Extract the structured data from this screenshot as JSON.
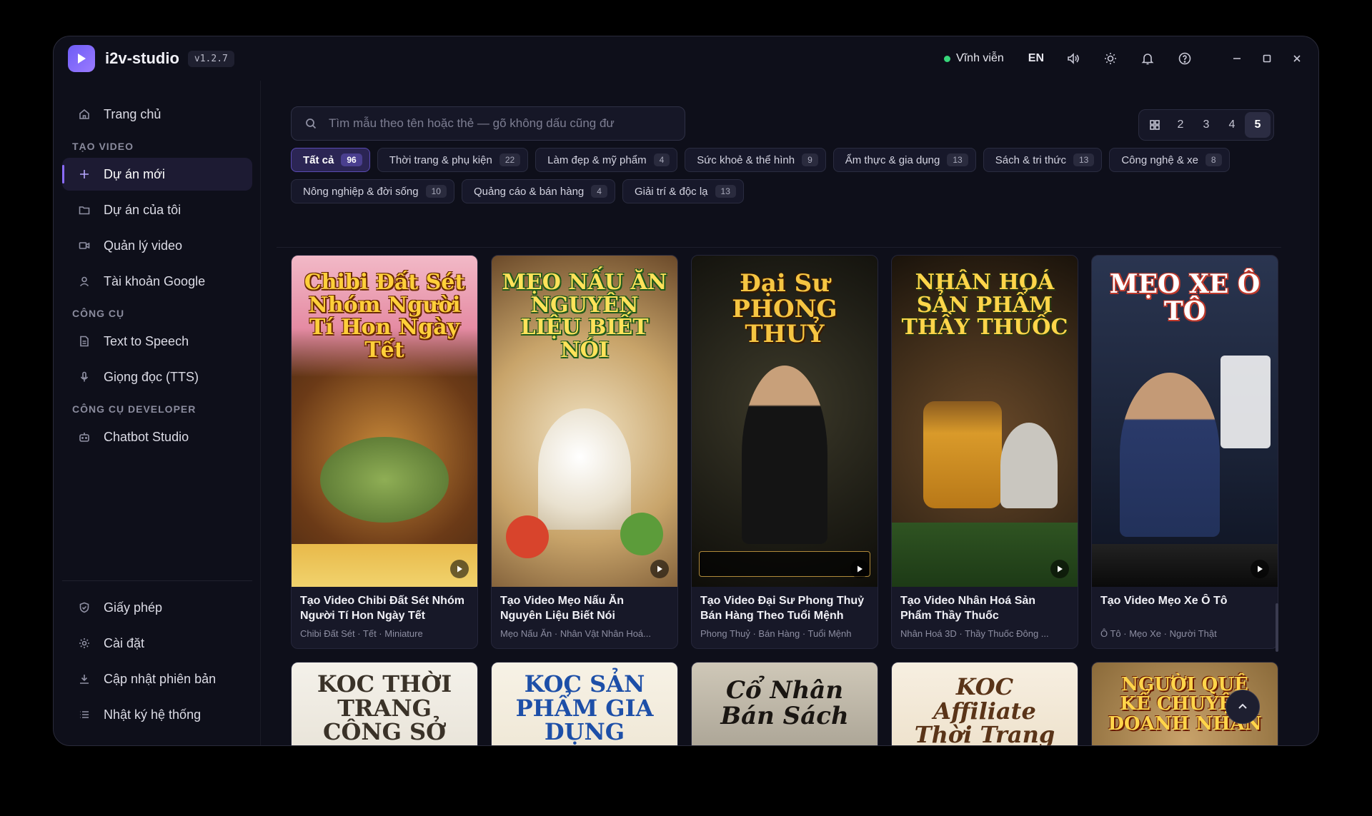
{
  "app": {
    "title": "i2v-studio",
    "version": "v1.2.7"
  },
  "titlebar": {
    "license": "Vĩnh viễn",
    "lang": "EN"
  },
  "sidebar": {
    "home": "Trang chủ",
    "section_video": "TẠO VIDEO",
    "new_project": "Dự án mới",
    "my_projects": "Dự án của tôi",
    "manage_video": "Quản lý video",
    "google_account": "Tài khoản Google",
    "section_tools": "CÔNG CỤ",
    "tts": "Text to Speech",
    "voice": "Giọng đọc (TTS)",
    "section_dev": "CÔNG CỤ DEVELOPER",
    "chatbot": "Chatbot Studio",
    "license": "Giấy phép",
    "settings": "Cài đặt",
    "update": "Cập nhật phiên bản",
    "logs": "Nhật ký hệ thống"
  },
  "search": {
    "placeholder": "Tìm mẫu theo tên hoặc thẻ — gõ không dấu cũng đư"
  },
  "columns": {
    "options": [
      "2",
      "3",
      "4",
      "5"
    ],
    "selected": "5"
  },
  "chips": [
    {
      "label": "Tất cả",
      "count": "96"
    },
    {
      "label": "Thời trang & phụ kiện",
      "count": "22"
    },
    {
      "label": "Làm đẹp & mỹ phẩm",
      "count": "4"
    },
    {
      "label": "Sức khoẻ & thể hình",
      "count": "9"
    },
    {
      "label": "Ẩm thực & gia dụng",
      "count": "13"
    },
    {
      "label": "Sách & tri thức",
      "count": "13"
    },
    {
      "label": "Công nghệ & xe",
      "count": "8"
    },
    {
      "label": "Nông nghiệp & đời sống",
      "count": "10"
    },
    {
      "label": "Quảng cáo & bán hàng",
      "count": "4"
    },
    {
      "label": "Giải trí & độc lạ",
      "count": "13"
    }
  ],
  "cards": [
    {
      "thumb_text": "Chibi Đất Sét Nhóm Người Tí Hon Ngày Tết",
      "title": "Tạo Video Chibi Đất Sét Nhóm Người Tí Hon Ngày Tết",
      "tags": "Chibi Đất Sét · Tết · Miniature"
    },
    {
      "thumb_text": "MẸO NẤU ĂN NGUYÊN LIỆU BIẾT NÓI",
      "title": "Tạo Video Mẹo Nấu Ăn Nguyên Liệu Biết Nói",
      "tags": "Mẹo Nấu Ăn · Nhân Vật Nhân Hoá..."
    },
    {
      "thumb_text": "Đại Sư PHONG THUỶ",
      "title": "Tạo Video Đại Sư Phong Thuỷ Bán Hàng Theo Tuổi Mệnh",
      "tags": "Phong Thuỷ · Bán Hàng · Tuổi Mệnh"
    },
    {
      "thumb_text": "NHÂN HOÁ SẢN PHẨM THẦY THUỐC",
      "title": "Tạo Video Nhân Hoá Sản Phẩm Thầy Thuốc",
      "tags": "Nhân Hoá 3D · Thầy Thuốc Đông ..."
    },
    {
      "thumb_text": "MẸO XE Ô TÔ",
      "title": "Tạo Video Mẹo Xe Ô Tô",
      "tags": "Ô Tô · Mẹo Xe · Người Thật"
    }
  ],
  "cards_row2": [
    {
      "thumb_text": "KOC THỜI TRANG CÔNG SỞ"
    },
    {
      "thumb_text": "KOC SẢN PHẨM GIA DỤNG"
    },
    {
      "thumb_text": "Cổ Nhân Bán Sách"
    },
    {
      "thumb_text": "KOC Affiliate Thời Trang"
    },
    {
      "thumb_text": "NGƯỜI QUÊ KỂ CHUYỆN DOANH NHÂN"
    }
  ]
}
